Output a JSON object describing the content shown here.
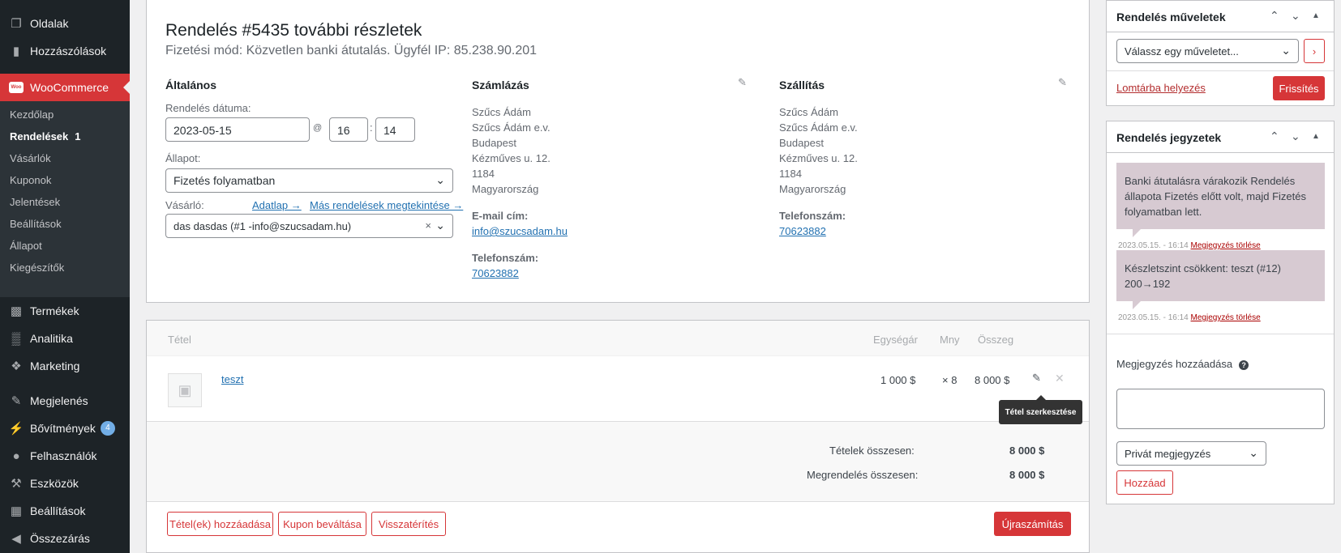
{
  "sidebar": {
    "top_items": [
      {
        "label": "Oldalak",
        "icon": "pages-icon"
      },
      {
        "label": "Hozzászólások",
        "icon": "comments-icon"
      },
      {
        "label": "WooCommerce",
        "icon": "woocommerce-icon",
        "icon_text": "Woo"
      }
    ],
    "submenu": [
      {
        "label": "Kezdőlap"
      },
      {
        "label": "Rendelések",
        "count": "1"
      },
      {
        "label": "Vásárlók"
      },
      {
        "label": "Kuponok"
      },
      {
        "label": "Jelentések"
      },
      {
        "label": "Beállítások"
      },
      {
        "label": "Állapot"
      },
      {
        "label": "Kiegészítők"
      }
    ],
    "bottom_items": [
      {
        "label": "Termékek",
        "icon": "products-icon"
      },
      {
        "label": "Analitika",
        "icon": "analytics-icon"
      },
      {
        "label": "Marketing",
        "icon": "marketing-icon"
      },
      {
        "label": "Megjelenés",
        "icon": "appearance-icon"
      },
      {
        "label": "Bővítmények",
        "icon": "plugins-icon",
        "badge": "4"
      },
      {
        "label": "Felhasználók",
        "icon": "users-icon"
      },
      {
        "label": "Eszközök",
        "icon": "tools-icon"
      },
      {
        "label": "Beállítások",
        "icon": "settings-icon"
      },
      {
        "label": "Összezárás",
        "icon": "collapse-icon"
      }
    ]
  },
  "order": {
    "title": "Rendelés #5435 további részletek",
    "subtitle": "Fizetési mód: Közvetlen banki átutalás. Ügyfél IP: 85.238.90.201",
    "general": {
      "heading": "Általános",
      "date_label": "Rendelés dátuma:",
      "date_value": "2023-05-15",
      "at": "@",
      "hour": "16",
      "colon": ":",
      "minute": "14",
      "status_label": "Állapot:",
      "status_value": "Fizetés folyamatban",
      "customer_label": "Vásárló:",
      "profile_link": "Adatlap →",
      "other_orders_link": "Más rendelések megtekintése →",
      "customer_value": "das dasdas (#1 -info@szucsadam.hu)",
      "clear": "×"
    },
    "billing": {
      "heading": "Számlázás",
      "address": [
        "Szűcs Ádám",
        "Szűcs Ádám e.v.",
        "Budapest",
        "Kézműves u. 12.",
        "1184",
        "Magyarország"
      ],
      "email_label": "E-mail cím:",
      "email": "info@szucsadam.hu",
      "phone_label": "Telefonszám:",
      "phone": "70623882"
    },
    "shipping": {
      "heading": "Szállítás",
      "address": [
        "Szűcs Ádám",
        "Szűcs Ádám e.v.",
        "Budapest",
        "Kézműves u. 12.",
        "1184",
        "Magyarország"
      ],
      "phone_label": "Telefonszám:",
      "phone": "70623882"
    }
  },
  "items": {
    "headers": {
      "item": "Tétel",
      "unit_price": "Egységár",
      "qty": "Mny",
      "total": "Összeg"
    },
    "rows": [
      {
        "name": "teszt",
        "unit_price": "1 000 $",
        "qty": "× 8",
        "total": "8 000 $"
      }
    ],
    "tooltip": "Tétel szerkesztése",
    "items_total_label": "Tételek összesen:",
    "items_total": "8 000 $",
    "order_total_label": "Megrendelés összesen:",
    "order_total": "8 000 $",
    "buttons": {
      "add_items": "Tétel(ek) hozzáadása",
      "apply_coupon": "Kupon beváltása",
      "refund": "Visszatérítés",
      "recalculate": "Újraszámítás"
    }
  },
  "actions_box": {
    "title": "Rendelés műveletek",
    "select_value": "Válassz egy műveletet...",
    "trash_link": "Lomtárba helyezés",
    "update_button": "Frissítés"
  },
  "notes_box": {
    "title": "Rendelés jegyzetek",
    "notes": [
      {
        "text": "Banki átutalásra várakozik Rendelés állapota Fizetés előtt volt, majd Fizetés folyamatban lett.",
        "date": "2023.05.15. - 16:14",
        "delete": "Megjegyzés törlése"
      },
      {
        "text": "Készletszint csökkent: teszt (#12) 200→192",
        "date": "2023.05.15. - 16:14",
        "delete": "Megjegyzés törlése"
      }
    ],
    "add_label": "Megjegyzés hozzáadása",
    "help": "?",
    "type_value": "Privát megjegyzés",
    "add_button": "Hozzáad"
  }
}
